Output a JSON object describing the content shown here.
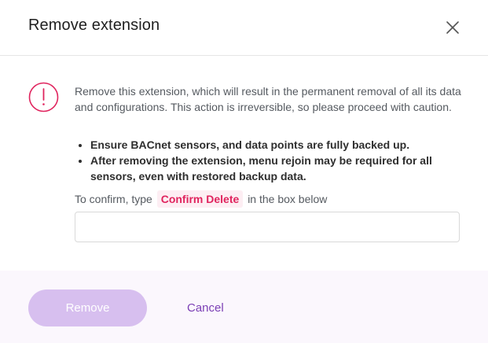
{
  "dialog": {
    "title": "Remove extension",
    "close_icon": "close-icon"
  },
  "warning": {
    "icon": "exclamation-circle-icon",
    "icon_color": "#e0245e",
    "description": "Remove this extension, which will result in the permanent removal of all its data and configurations. This action is irreversible, so please proceed with caution.",
    "bullets": [
      "Ensure BACnet sensors, and data points are fully backed up.",
      "After removing the extension, menu rejoin may be required for all sensors, even with restored backup data."
    ]
  },
  "confirm": {
    "prefix": "To confirm, type",
    "keyword": "Confirm Delete",
    "suffix": "in the box below",
    "input_value": "",
    "input_placeholder": ""
  },
  "footer": {
    "remove_label": "Remove",
    "cancel_label": "Cancel",
    "accent_color": "#7b3fb5"
  }
}
